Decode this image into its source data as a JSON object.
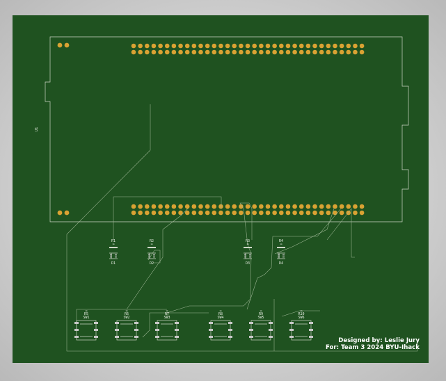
{
  "board": {
    "colors": {
      "soldermask": "#1f5220",
      "outline": "#cfd8c8",
      "pad": "#d9a233",
      "trace": "#9fb896"
    }
  },
  "module": {
    "ref": "U1"
  },
  "resistors_top": [
    {
      "ref": "R1",
      "value": "1k"
    },
    {
      "ref": "R2",
      "value": "1k"
    },
    {
      "ref": "R3",
      "value": "1k"
    },
    {
      "ref": "R4",
      "value": "1k"
    }
  ],
  "leds": [
    {
      "ref": "D1"
    },
    {
      "ref": "D2"
    },
    {
      "ref": "D3"
    },
    {
      "ref": "D4"
    }
  ],
  "switches": [
    {
      "ref": "SW1",
      "res_ref": "R5",
      "res_value": "1k"
    },
    {
      "ref": "SW2",
      "res_ref": "R6",
      "res_value": "1k"
    },
    {
      "ref": "SW3",
      "res_ref": "R7",
      "res_value": "1k"
    },
    {
      "ref": "SW4",
      "res_ref": "R8",
      "res_value": "1k"
    },
    {
      "ref": "SW5",
      "res_ref": "R9",
      "res_value": "1k"
    },
    {
      "ref": "SW6",
      "res_ref": "R10",
      "res_value": "1k"
    }
  ],
  "credits": {
    "line1": "Designed by: Leslie Jury",
    "line2": "For: Team 3 2024 BYU-Ihack"
  }
}
